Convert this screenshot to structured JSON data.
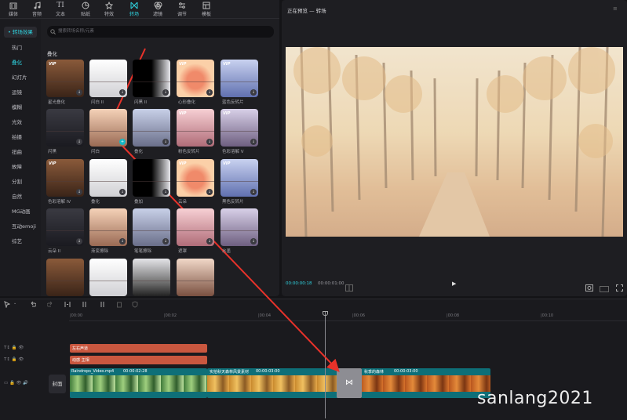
{
  "toolbar": {
    "items": [
      {
        "label": "媒体",
        "icon": "media-icon"
      },
      {
        "label": "音频",
        "icon": "audio-icon"
      },
      {
        "label": "文本",
        "icon": "text-icon"
      },
      {
        "label": "贴纸",
        "icon": "sticker-icon"
      },
      {
        "label": "特效",
        "icon": "effects-icon"
      },
      {
        "label": "转场",
        "icon": "transition-icon"
      },
      {
        "label": "滤镜",
        "icon": "filter-icon"
      },
      {
        "label": "调节",
        "icon": "adjust-icon"
      },
      {
        "label": "模板",
        "icon": "template-icon"
      }
    ],
    "active": "转场",
    "text_icon_glyph": "TI"
  },
  "sidebar": {
    "header": "• 转场效果",
    "items": [
      "热门",
      "叠化",
      "幻灯片",
      "运镜",
      "模糊",
      "光效",
      "拍摄",
      "扭曲",
      "故障",
      "分割",
      "自然",
      "MG动画",
      "互动emoji",
      "综艺"
    ],
    "selected": "叠化"
  },
  "search": {
    "placeholder": "搜索转场名称/元素"
  },
  "section_title": "叠化",
  "thumbs": [
    {
      "label": "星光叠化",
      "vip": true
    },
    {
      "label": "闪白 II",
      "vip": false
    },
    {
      "label": "闪黑 II",
      "vip": false
    },
    {
      "label": "心形叠化",
      "vip": true
    },
    {
      "label": "蓝色反转片",
      "vip": true
    },
    {
      "label": "闪黑",
      "vip": false
    },
    {
      "label": "闪白",
      "vip": false
    },
    {
      "label": "叠化",
      "vip": false
    },
    {
      "label": "粉色反转片",
      "vip": true
    },
    {
      "label": "色彩溶解 V",
      "vip": true
    },
    {
      "label": "色彩溶解 IV",
      "vip": true
    },
    {
      "label": "叠化",
      "vip": false
    },
    {
      "label": "叠加",
      "vip": false
    },
    {
      "label": "云朵",
      "vip": true
    },
    {
      "label": "黑色反转片",
      "vip": true
    },
    {
      "label": "云朵 II",
      "vip": false
    },
    {
      "label": "渐变擦除",
      "vip": false
    },
    {
      "label": "笔笔擦除",
      "vip": false
    },
    {
      "label": "遮罩",
      "vip": false
    },
    {
      "label": "水墨",
      "vip": false
    },
    {
      "label": "",
      "vip": false
    },
    {
      "label": "",
      "vip": false
    },
    {
      "label": "",
      "vip": false
    },
    {
      "label": "",
      "vip": false
    }
  ],
  "preview": {
    "title": "正在预览 — 转场",
    "menu": "≡",
    "time_current": "00:00:00:18",
    "time_total": "00:00:01:00",
    "play": "▶"
  },
  "timeline": {
    "ticks": [
      "|00:00",
      "|00:02",
      "|00:04",
      "|00:06",
      "|00:08",
      "|00:10"
    ],
    "text_clips": [
      {
        "name": "左右声道"
      },
      {
        "name": "动感 主相"
      }
    ],
    "video_clips": [
      {
        "name": "Raindrops_Video.mp4",
        "duration": "00:00:02:28"
      },
      {
        "name": "实拍秋天森林风景素材",
        "duration": "00:00:03:00"
      },
      {
        "name": "秋季的森林",
        "duration": "00:00:03:00"
      }
    ],
    "cover_label": "封面",
    "transition_glyph": "⋈"
  },
  "watermark": "sanlang2021",
  "colors": {
    "accent": "#2fd3e0",
    "arrow": "#e8322a",
    "video_track": "#0e6f78",
    "text_track": "#c9573f"
  }
}
